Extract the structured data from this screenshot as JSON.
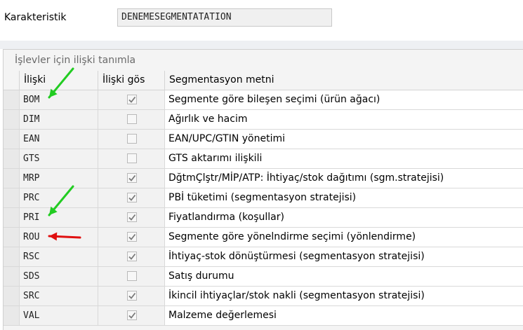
{
  "characteristic": {
    "label": "Karakteristik",
    "value": "DENEMESEGMENTATATION"
  },
  "panel": {
    "title": "İşlevler için ilişki tanımla"
  },
  "table": {
    "headers": {
      "relation": "İlişki",
      "shown": "İlişki gös",
      "text": "Segmentasyon metni"
    },
    "rows": [
      {
        "code": "BOM",
        "checked": true,
        "text": "Segmente göre bileşen seçimi (ürün ağacı)"
      },
      {
        "code": "DIM",
        "checked": false,
        "text": "Ağırlık ve hacim"
      },
      {
        "code": "EAN",
        "checked": false,
        "text": "EAN/UPC/GTIN yönetimi"
      },
      {
        "code": "GTS",
        "checked": false,
        "text": "GTS aktarımı ilişkili"
      },
      {
        "code": "MRP",
        "checked": true,
        "text": "DğtmÇlştr/MİP/ATP: İhtiyaç/stok dağıtımı (sgm.stratejisi)"
      },
      {
        "code": "PRC",
        "checked": true,
        "text": "PBİ tüketimi (segmentasyon stratejisi)"
      },
      {
        "code": "PRI",
        "checked": true,
        "text": "Fiyatlandırma (koşullar)"
      },
      {
        "code": "ROU",
        "checked": true,
        "text": "Segmente göre yönelndirme seçimi (yönlendirme)"
      },
      {
        "code": "RSC",
        "checked": true,
        "text": "İhtiyaç-stok dönüştürmesi (segmentasyon stratejisi)"
      },
      {
        "code": "SDS",
        "checked": false,
        "text": "Satış durumu"
      },
      {
        "code": "SRC",
        "checked": true,
        "text": "İkincil ihtiyaçlar/stok nakli (segmentasyon stratejisi)"
      },
      {
        "code": "VAL",
        "checked": true,
        "text": "Malzeme değerlemesi"
      }
    ]
  },
  "annotations": {
    "green_color": "#22cc22",
    "red_color": "#e01010",
    "green_arrows": [
      "BOM",
      "PRI"
    ],
    "red_arrows": [
      "ROU"
    ]
  }
}
